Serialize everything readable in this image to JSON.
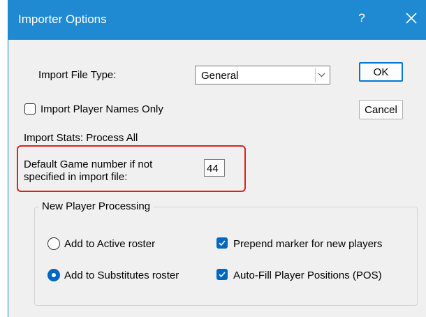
{
  "window": {
    "title": "Importer Options",
    "help_label": "?"
  },
  "form": {
    "file_type_label": "Import File Type:",
    "file_type_value": "General",
    "player_names_only_label": "Import Player Names Only",
    "player_names_only_checked": false,
    "import_stats_label": "Import Stats: Process All",
    "default_game_label_line1": "Default Game number if not",
    "default_game_label_line2": "specified in import file:",
    "default_game_value": "44"
  },
  "buttons": {
    "ok_label": "OK",
    "cancel_label": "Cancel"
  },
  "new_player_processing": {
    "title": "New Player Processing",
    "radio_active_label": "Add to Active roster",
    "radio_active_selected": false,
    "radio_substitutes_label": "Add to Substitutes roster",
    "radio_substitutes_selected": true,
    "prepend_marker_label": "Prepend marker for new players",
    "prepend_marker_checked": true,
    "autofill_positions_label": "Auto-Fill Player Positions (POS)",
    "autofill_positions_checked": true
  },
  "colors": {
    "titlebar": "#1f8ad2",
    "accent": "#0067c0",
    "highlight": "#e02020"
  },
  "icons": {
    "close": "close-icon",
    "dropdown": "chevron-down-icon",
    "check": "checkmark-icon"
  }
}
